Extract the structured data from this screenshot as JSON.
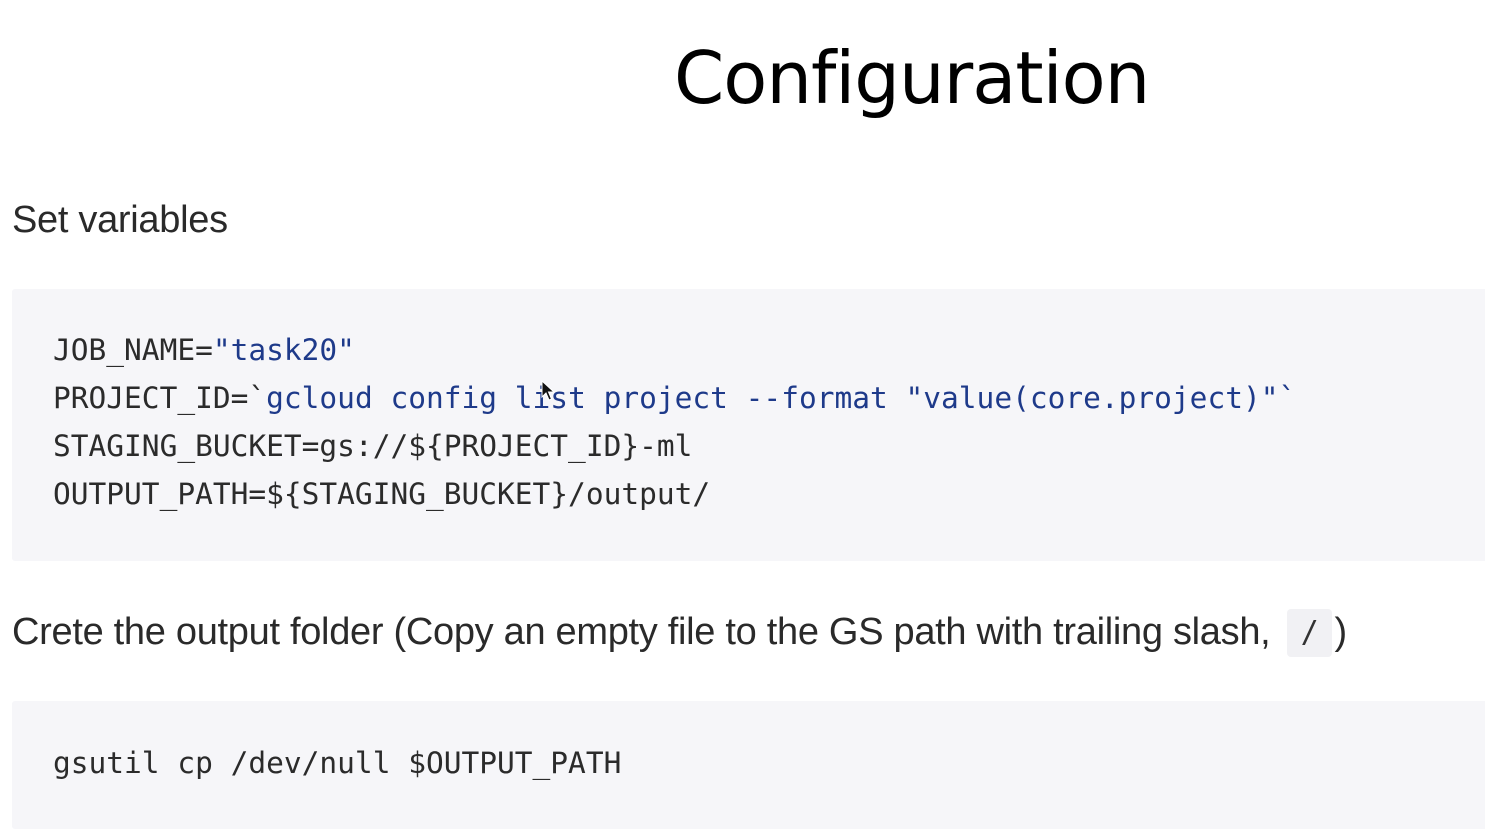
{
  "slide": {
    "title": "Configuration"
  },
  "section1": {
    "heading": "Set variables",
    "code_lines": [
      {
        "plain": "JOB_NAME=",
        "string": "\"task20\""
      },
      {
        "plain": "PROJECT_ID=`",
        "string": "gcloud config list project --format \"value(core.project)\"`"
      },
      {
        "plain": "STAGING_BUCKET=gs://${PROJECT_ID}-ml",
        "string": ""
      },
      {
        "plain": "OUTPUT_PATH=${STAGING_BUCKET}/output/",
        "string": ""
      }
    ]
  },
  "section2": {
    "heading_prefix": "Crete the output folder (Copy an empty file to the GS path with trailing slash, ",
    "inline_code": "/",
    "heading_suffix": ")",
    "code_lines": [
      {
        "plain": "gsutil cp /dev/null $OUTPUT_PATH",
        "string": ""
      }
    ]
  },
  "colors": {
    "code_background": "#f6f6f9",
    "string_token": "#1e3a8a",
    "text": "#2a2a2a"
  },
  "icons": {
    "cursor": "mouse-pointer-icon"
  }
}
